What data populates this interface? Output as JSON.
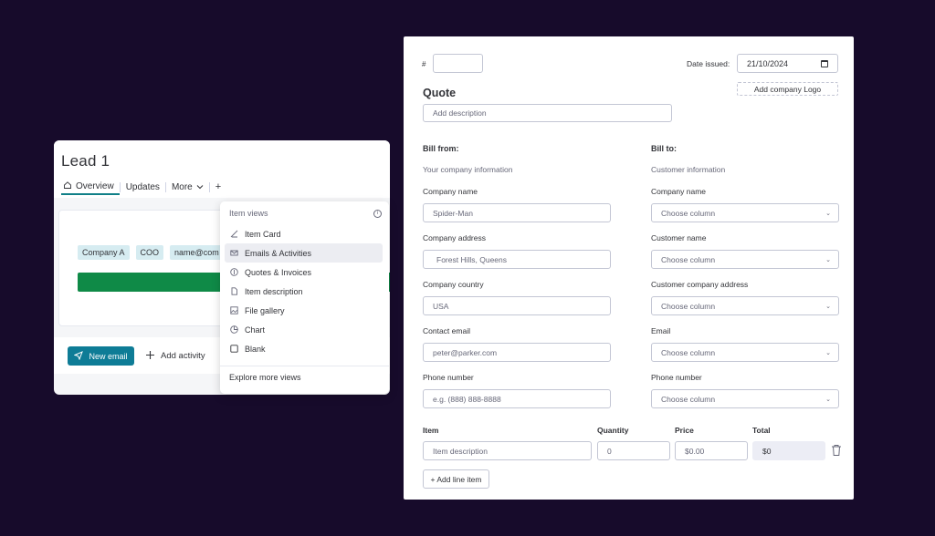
{
  "colors": {
    "background": "#170b2b",
    "accent_teal": "#0e7c96",
    "tab_underline": "#0f7f87",
    "green_bar": "#0f8a47",
    "chip_bg": "#d6ecf1"
  },
  "lead": {
    "title": "Lead 1",
    "tabs": [
      {
        "label": "Overview",
        "icon": "home-icon",
        "active": true
      },
      {
        "label": "Updates",
        "active": false
      },
      {
        "label": "More",
        "icon": "chevron-down-icon",
        "active": false
      },
      {
        "label": "+",
        "active": false
      }
    ],
    "chips": [
      "Company A",
      "COO",
      "name@com"
    ],
    "footer": {
      "new_email": "New email",
      "add_activity": "Add activity"
    }
  },
  "item_views_menu": {
    "header": "Item views",
    "info_icon": "i",
    "items": [
      {
        "label": "Item Card",
        "icon": "card-icon"
      },
      {
        "label": "Emails & Activities",
        "icon": "mail-icon",
        "hovered": true
      },
      {
        "label": "Quotes & Invoices",
        "icon": "dollar-icon"
      },
      {
        "label": "Item description",
        "icon": "document-icon"
      },
      {
        "label": "File gallery",
        "icon": "gallery-icon"
      },
      {
        "label": "Chart",
        "icon": "chart-icon"
      },
      {
        "label": "Blank",
        "icon": "square-icon"
      }
    ],
    "footer": "Explore more views"
  },
  "quote": {
    "hash_label": "#",
    "number_value": "",
    "date_label": "Date issued:",
    "date_value": "21/10/2024",
    "add_logo": "Add company Logo",
    "title": "Quote",
    "description_placeholder": "Add description",
    "bill_from": {
      "title": "Bill from:",
      "subtitle": "Your company information",
      "fields": [
        {
          "label": "Company name",
          "value": "Spider-Man"
        },
        {
          "label": "Company address",
          "value": "Forest Hills, Queens"
        },
        {
          "label": "Company country",
          "value": "USA"
        },
        {
          "label": "Contact email",
          "value": "peter@parker.com"
        },
        {
          "label": "Phone number",
          "placeholder": "e.g. (888) 888-8888"
        }
      ]
    },
    "bill_to": {
      "title": "Bill to:",
      "subtitle": "Customer information",
      "fields": [
        {
          "label": "Company name",
          "value": "Choose column"
        },
        {
          "label": "Customer name",
          "value": "Choose column"
        },
        {
          "label": "Customer company address",
          "value": "Choose column"
        },
        {
          "label": "Email",
          "value": "Choose column"
        },
        {
          "label": "Phone number",
          "value": "Choose column"
        }
      ]
    },
    "line_items": {
      "headers": [
        "Item",
        "Quantity",
        "Price",
        "Total"
      ],
      "row": {
        "item_placeholder": "Item description",
        "quantity": "0",
        "price": "$0.00",
        "total": "$0"
      },
      "add_line": "+ Add line item"
    }
  }
}
